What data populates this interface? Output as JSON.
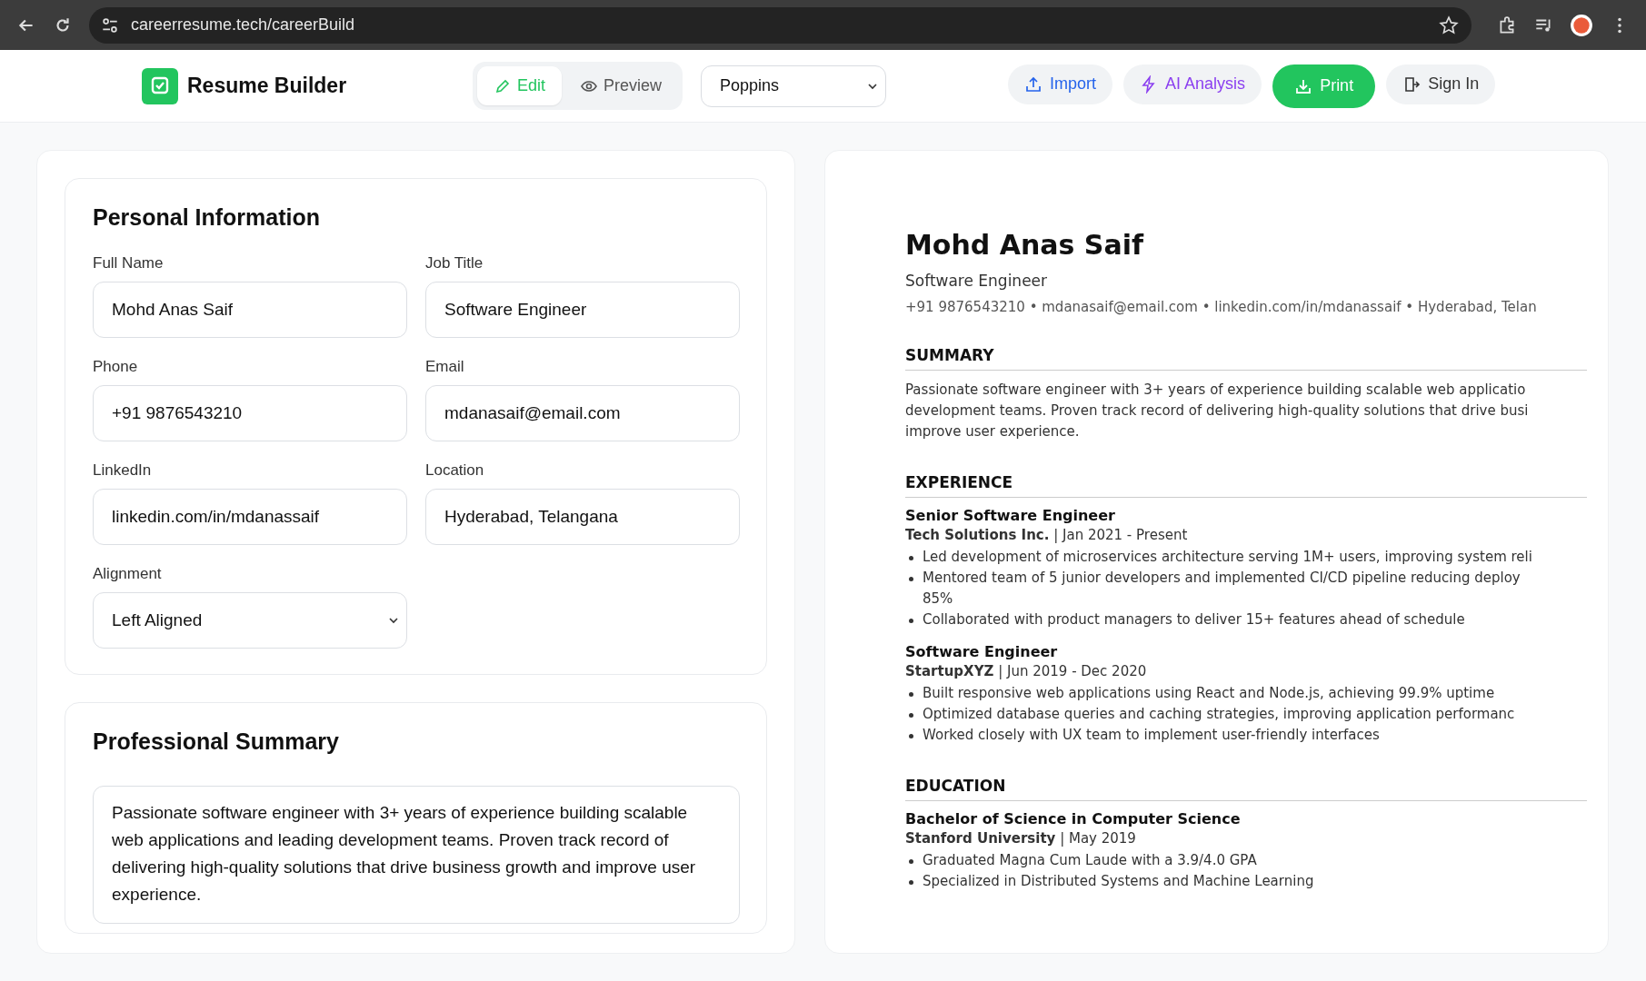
{
  "browser": {
    "url": "careerresume.tech/careerBuild"
  },
  "header": {
    "brand": "Resume Builder",
    "view_modes": [
      {
        "label": "Edit",
        "kind": "edit",
        "selected": true
      },
      {
        "label": "Preview",
        "kind": "preview",
        "selected": false
      }
    ],
    "font_select": {
      "value": "Poppins"
    },
    "actions": [
      {
        "label": "Import",
        "kind": "import"
      },
      {
        "label": "AI Analysis",
        "kind": "ai"
      },
      {
        "label": "Print",
        "kind": "print"
      },
      {
        "label": "Sign In",
        "kind": "signin"
      }
    ]
  },
  "personal_information": {
    "title": "Personal Information",
    "fields": [
      {
        "label": "Full Name",
        "value": "Mohd Anas Saif"
      },
      {
        "label": "Job Title",
        "value": "Software Engineer"
      },
      {
        "label": "Phone",
        "value": "+91 9876543210"
      },
      {
        "label": "Email",
        "value": "mdanasaif@email.com"
      },
      {
        "label": "LinkedIn",
        "value": "linkedin.com/in/mdanassaif"
      },
      {
        "label": "Location",
        "value": "Hyderabad, Telangana"
      }
    ],
    "alignment": {
      "label": "Alignment",
      "value": "Left Aligned"
    }
  },
  "professional_summary": {
    "title": "Professional Summary",
    "text": "Passionate software engineer with 3+ years of experience building scalable web applications and leading development teams. Proven track record of delivering high-quality solutions that drive business growth and improve user experience."
  },
  "resume": {
    "name": "Mohd Anas Saif",
    "job_title": "Software Engineer",
    "contact": "+91 9876543210 • mdanasaif@email.com • linkedin.com/in/mdanassaif • Hyderabad, Telan",
    "sections": [
      {
        "heading": "SUMMARY",
        "kind": "text",
        "lines": [
          "Passionate software engineer with 3+ years of experience building scalable web applicatio",
          "development teams. Proven track record of delivering high-quality solutions that drive busi",
          "improve user experience."
        ]
      },
      {
        "heading": "EXPERIENCE",
        "kind": "entries",
        "entries": [
          {
            "title": "Senior Software Engineer",
            "org": "Tech Solutions Inc.",
            "dates": "| Jan 2021 - Present",
            "bullets": [
              {
                "lines": [
                  "Led development of microservices architecture serving 1M+ users, improving system reli"
                ]
              },
              {
                "lines": [
                  "Mentored team of 5 junior developers and implemented CI/CD pipeline reducing deploy",
                  "85%"
                ]
              },
              {
                "lines": [
                  "Collaborated with product managers to deliver 15+ features ahead of schedule"
                ]
              }
            ]
          },
          {
            "title": "Software Engineer",
            "org": "StartupXYZ",
            "dates": "| Jun 2019 - Dec 2020",
            "bullets": [
              {
                "lines": [
                  "Built responsive web applications using React and Node.js, achieving 99.9% uptime"
                ]
              },
              {
                "lines": [
                  "Optimized database queries and caching strategies, improving application performanc"
                ]
              },
              {
                "lines": [
                  "Worked closely with UX team to implement user-friendly interfaces"
                ]
              }
            ]
          }
        ]
      },
      {
        "heading": "EDUCATION",
        "kind": "entries",
        "entries": [
          {
            "title": "Bachelor of Science in Computer Science",
            "org": "Stanford University",
            "dates": "| May 2019",
            "bullets": [
              {
                "lines": [
                  "Graduated Magna Cum Laude with a 3.9/4.0 GPA"
                ]
              },
              {
                "lines": [
                  "Specialized in Distributed Systems and Machine Learning"
                ]
              }
            ]
          }
        ]
      }
    ]
  }
}
